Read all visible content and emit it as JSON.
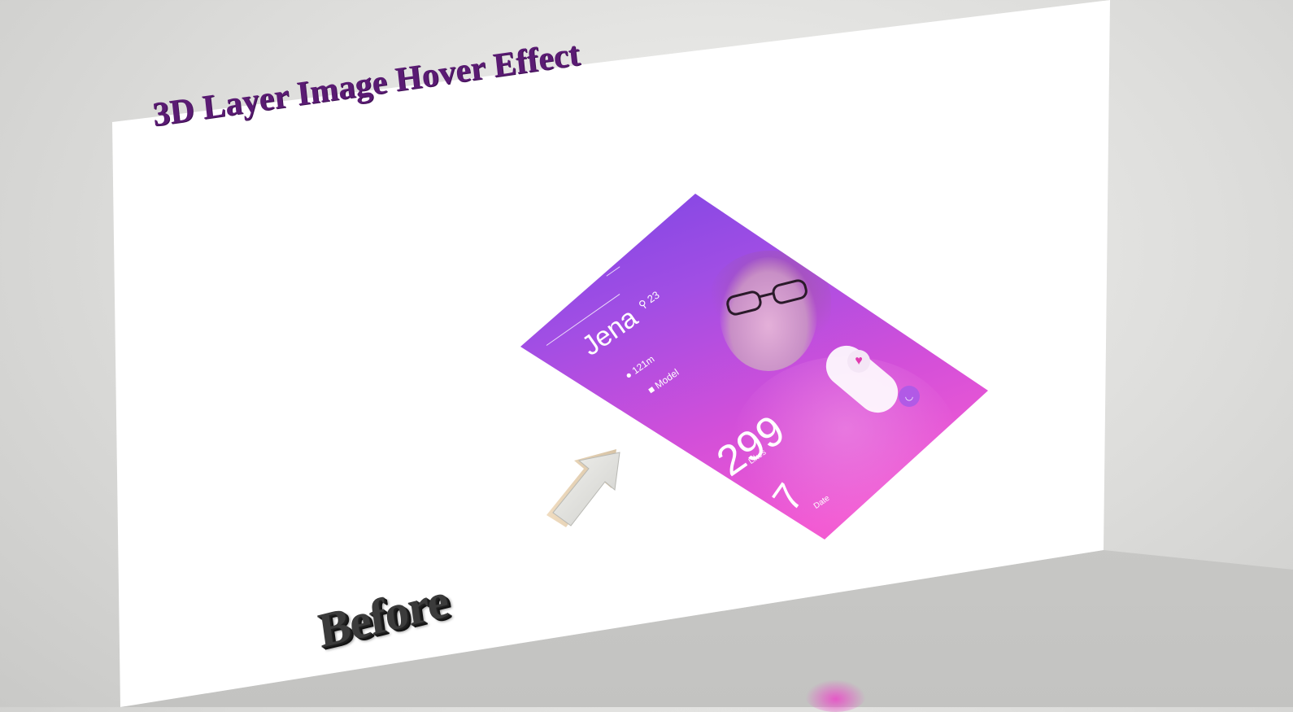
{
  "slide": {
    "title": "3D Layer Image Hover Effect",
    "caption": "Before"
  },
  "profile_card": {
    "name": "Jena",
    "age": "23",
    "distance": "121m",
    "occupation": "Model",
    "likes_count": "299",
    "likes_label": "Likes",
    "date_count": "7",
    "date_label": "Date",
    "gradient_colors": [
      "#7a45e4",
      "#d34fd9",
      "#f461cc"
    ],
    "icons": [
      "menu-icon",
      "location-pin-icon",
      "map-marker-icon",
      "briefcase-icon",
      "heart-icon",
      "chat-icon"
    ]
  },
  "colors": {
    "title": "#5a1b73",
    "caption": "#3b3b3b",
    "arrow": "#d9d9d6"
  }
}
